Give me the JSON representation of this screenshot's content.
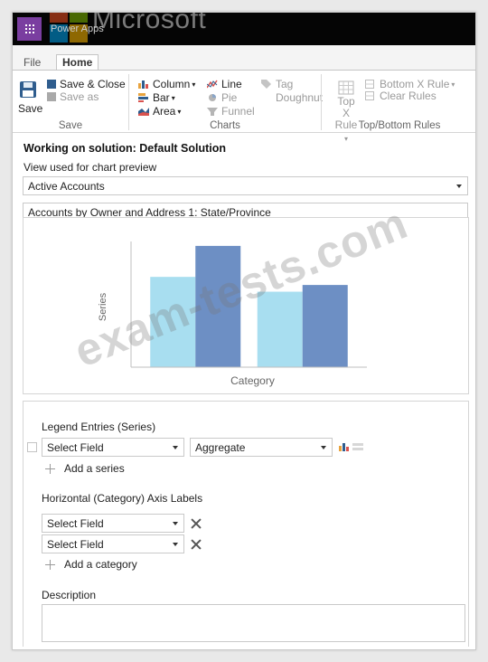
{
  "header": {
    "app_name": "Power Apps",
    "watermark_brand": "Microsoft",
    "logo_colors": [
      "#f25022",
      "#7fba00",
      "#00a4ef",
      "#ffb900"
    ]
  },
  "tabs": [
    "File",
    "Home"
  ],
  "ribbon": {
    "save": {
      "big_label": "Save",
      "save_close": "Save & Close",
      "save_as": "Save as",
      "group_label": "Save"
    },
    "charts": {
      "column": "Column",
      "bar": "Bar",
      "area": "Area",
      "line": "Line",
      "pie": "Pie",
      "funnel": "Funnel",
      "tag": "Tag",
      "doughnut": "Doughnut",
      "group_label": "Charts"
    },
    "topbottom": {
      "top_x_line1": "Top X",
      "top_x_line2": "Rule",
      "bottom_x": "Bottom X Rule",
      "clear_rules": "Clear Rules",
      "group_label": "Top/Bottom Rules"
    }
  },
  "main": {
    "solution_title": "Working on solution: Default Solution",
    "view_label": "View used for chart preview",
    "view_value": "Active Accounts",
    "chart_name": "Accounts by Owner and Address 1: State/Province"
  },
  "chart_data": {
    "type": "bar",
    "title": "",
    "xlabel": "Category",
    "ylabel": "Series",
    "categories": [
      "",
      ""
    ],
    "series": [
      {
        "values": [
          67,
          56
        ],
        "color": "#a8def0"
      },
      {
        "values": [
          90,
          61
        ],
        "color": "#6d8fc4"
      }
    ],
    "ylim": [
      0,
      100
    ],
    "grid": false
  },
  "config": {
    "legend_label": "Legend Entries (Series)",
    "series_field": "Select Field",
    "aggregate": "Aggregate",
    "add_series": "Add a series",
    "axis_label": "Horizontal (Category) Axis Labels",
    "category_field_1": "Select Field",
    "category_field_2": "Select Field",
    "add_category": "Add a category",
    "description_label": "Description"
  },
  "watermark": "exam-tests.com"
}
